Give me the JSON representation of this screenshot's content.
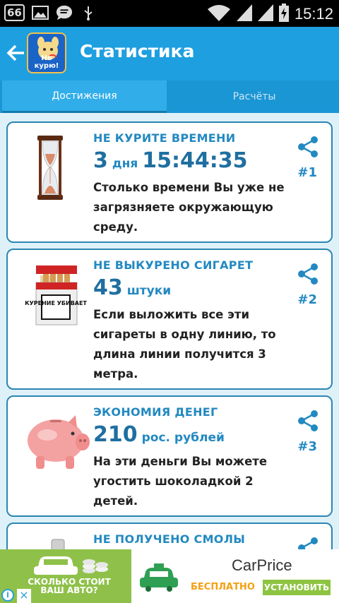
{
  "status_bar": {
    "badge": "66",
    "time": "15:12",
    "icons": [
      "photo-icon",
      "message-icon",
      "usb-icon",
      "wifi-icon",
      "signal-icon",
      "battery-charging-icon"
    ]
  },
  "app_bar": {
    "title": "Статистика",
    "logo_text": "Не курю!"
  },
  "tabs": [
    {
      "label": "Достижения",
      "active": true
    },
    {
      "label": "Расчёты",
      "active": false
    }
  ],
  "cards": [
    {
      "title": "НЕ КУРИТЕ ВРЕМЕНИ",
      "value_big1": "3",
      "value_unit": "дня",
      "value_big2": "15:44:35",
      "description": "Столько времени Вы уже не загрязняете окружающую среду.",
      "rank": "#1",
      "image": "hourglass-image"
    },
    {
      "title": "НЕ ВЫКУРЕНО СИГАРЕТ",
      "value_big1": "43",
      "value_unit": "штуки",
      "value_big2": "",
      "description": "Если выложить все эти сигареты в одну линию, то длина линии получится 3 метра.",
      "rank": "#2",
      "image": "cigarette-pack-image",
      "pack_text": "КУРЕНИЕ УБИВАЕТ"
    },
    {
      "title": "ЭКОНОМИЯ ДЕНЕГ",
      "value_big1": "210",
      "value_unit": "рос. рублей",
      "value_big2": "",
      "description": "На эти деньги Вы можете угостить шоколадкой 2 детей.",
      "rank": "#3",
      "image": "piggy-bank-image"
    },
    {
      "title": "НЕ ПОЛУЧЕНО СМОЛЫ",
      "value_big1": "",
      "value_unit": "",
      "value_big2": "",
      "description": "",
      "rank": "",
      "image": "tar-image"
    }
  ],
  "ad": {
    "left_text": "СКОЛЬКО СТОИТ ВАШ АВТО?",
    "app_name": "CarPrice",
    "free_label": "БЕСПЛАТНО",
    "install_label": "УСТАНОВИТЬ",
    "info_glyph": "i",
    "close_glyph": "×"
  },
  "colors": {
    "app_bar": "#1e9fe0",
    "accent": "#2389c1",
    "ad_green": "#8fc14a"
  }
}
